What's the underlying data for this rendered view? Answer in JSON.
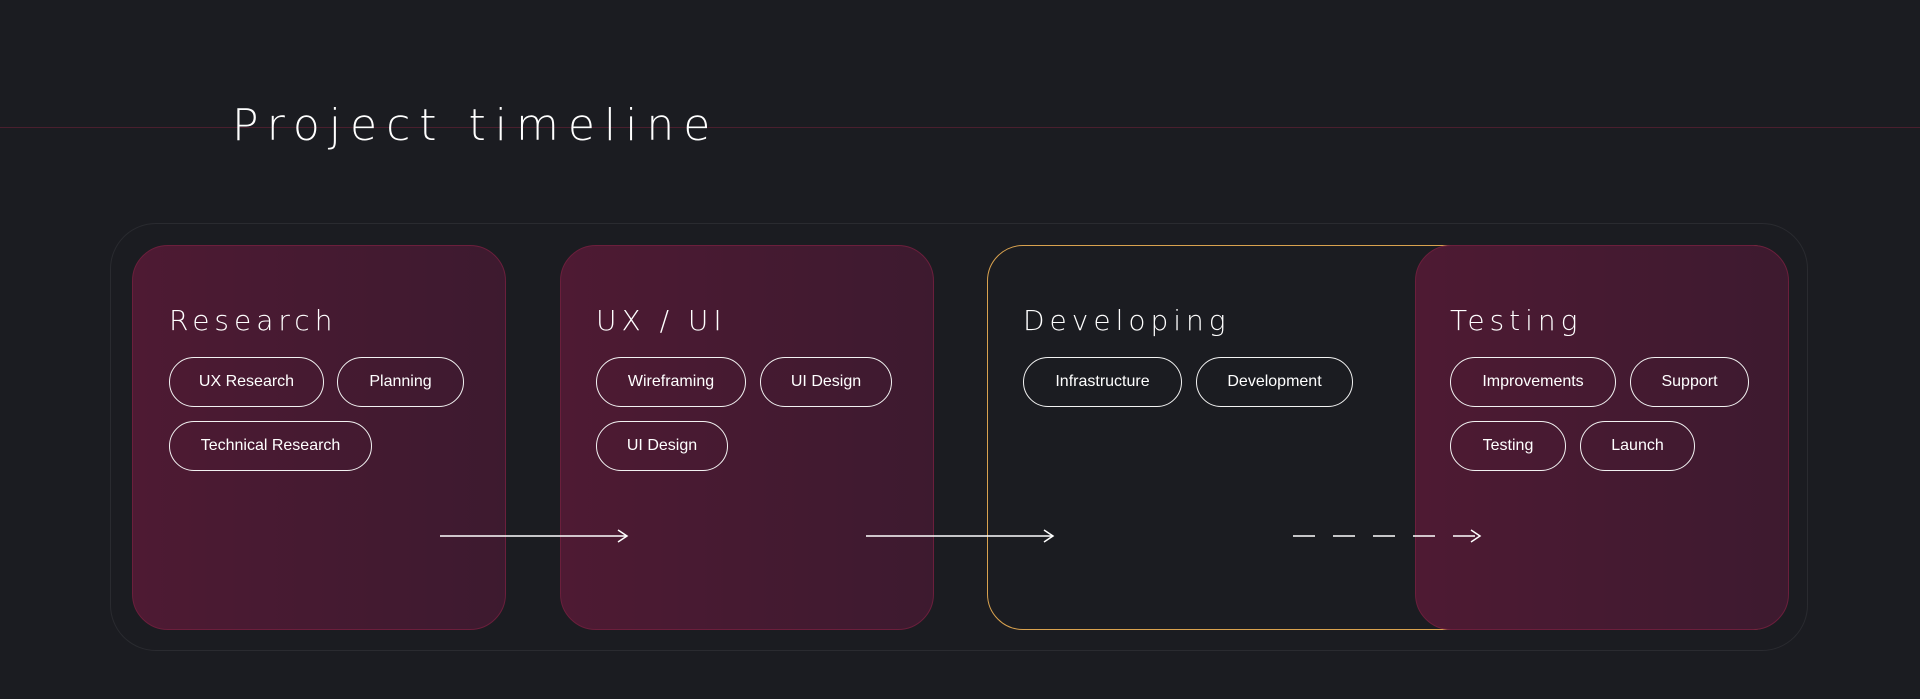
{
  "title": "Project timeline",
  "phases": [
    {
      "name": "Research",
      "tags": [
        "UX Research",
        "Planning",
        "Technical Research"
      ]
    },
    {
      "name": "UX / UI",
      "tags": [
        "Wireframing",
        "UI Design",
        "UI Design"
      ]
    },
    {
      "name": "Developing",
      "tags": [
        "Infrastructure",
        "Development"
      ]
    },
    {
      "name": "Testing",
      "tags": [
        "Improvements",
        "Support",
        "Testing",
        "Launch"
      ]
    }
  ],
  "colors": {
    "background": "#1b1c21",
    "card_fill": "#4a1a32",
    "card_border": "#6b1f3c",
    "developing_border": "#d9a24f",
    "text": "#ffffff"
  },
  "icons": [
    "arrow-right-icon",
    "dashed-arrow-right-icon"
  ]
}
